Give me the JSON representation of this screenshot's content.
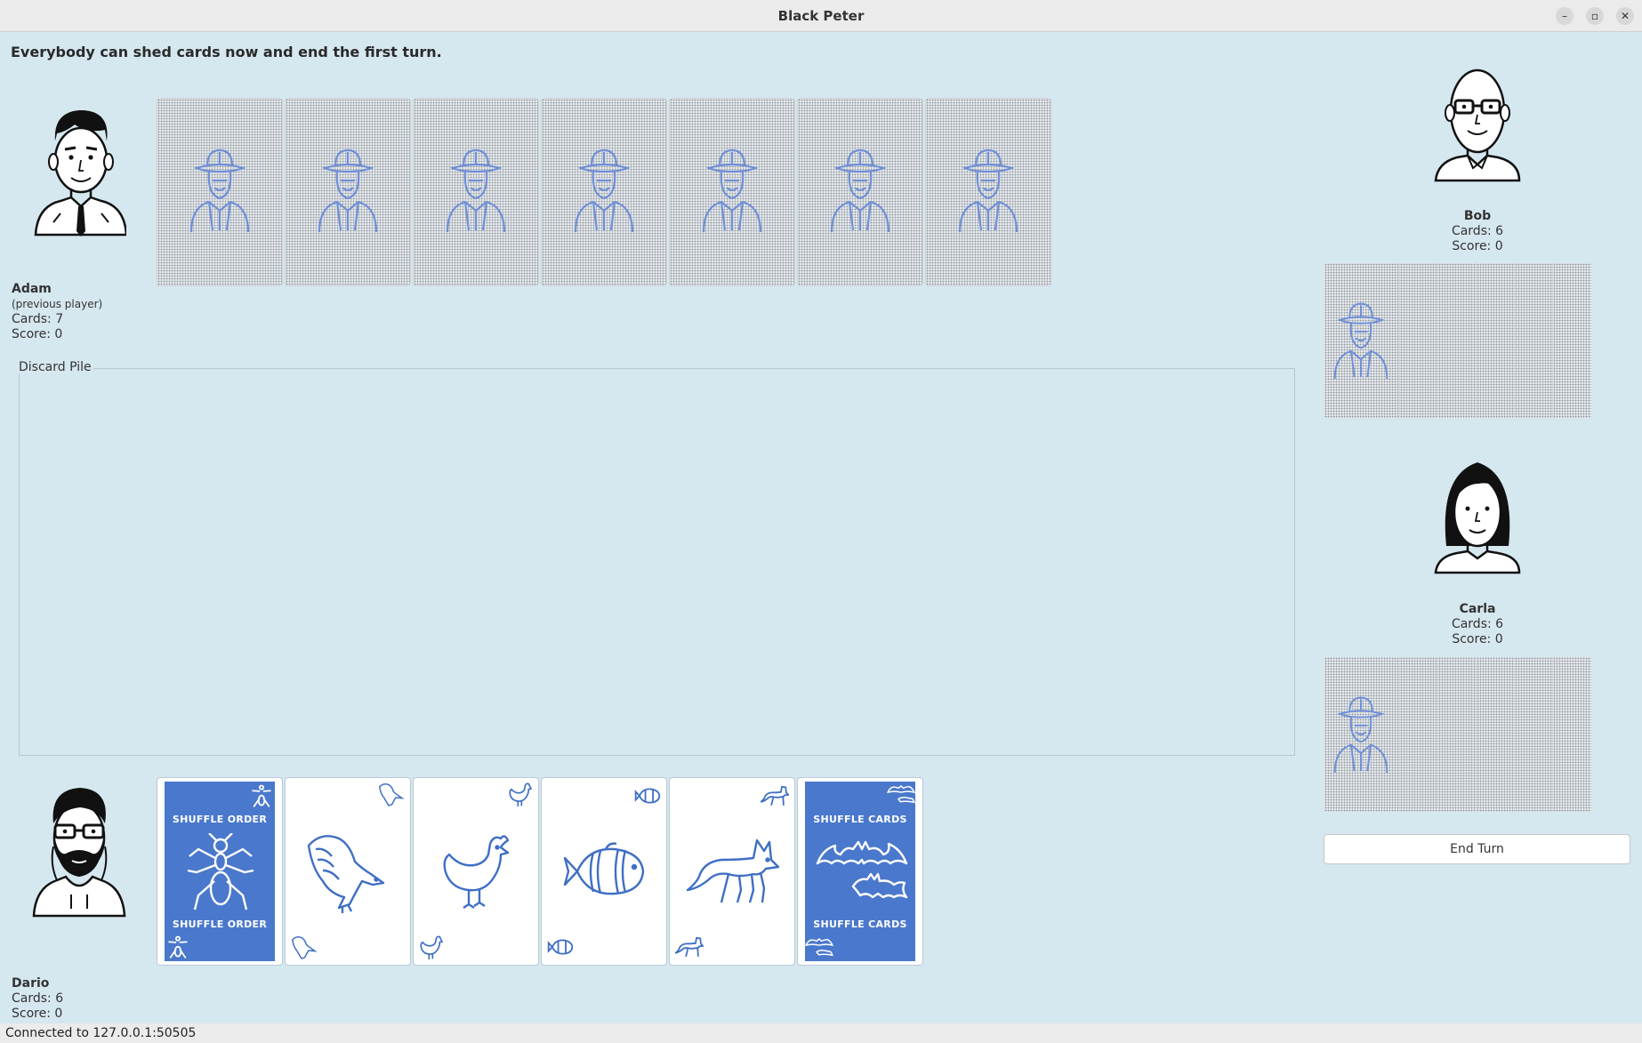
{
  "window": {
    "title": "Black Peter"
  },
  "status_message": "Everybody can shed cards now and end the first turn.",
  "players": {
    "adam": {
      "name": "Adam",
      "note": "(previous player)",
      "cards": "Cards: 7",
      "score": "Score: 0"
    },
    "bob": {
      "name": "Bob",
      "cards": "Cards: 6",
      "score": "Score: 0"
    },
    "carla": {
      "name": "Carla",
      "cards": "Cards: 6",
      "score": "Score: 0"
    },
    "dario": {
      "name": "Dario",
      "cards": "Cards: 6",
      "score": "Score: 0"
    }
  },
  "discard_pile": {
    "label": "Discard Pile"
  },
  "hand": {
    "cards": [
      {
        "kind": "action",
        "top_label": "SHUFFLE ORDER",
        "bottom_label": "SHUFFLE ORDER",
        "icon": "ant-icon"
      },
      {
        "kind": "animal",
        "icon": "eagle-icon"
      },
      {
        "kind": "animal",
        "icon": "chicken-icon"
      },
      {
        "kind": "animal",
        "icon": "clownfish-icon"
      },
      {
        "kind": "animal",
        "icon": "fox-icon"
      },
      {
        "kind": "action",
        "top_label": "SHUFFLE CARDS",
        "bottom_label": "SHUFFLE CARDS",
        "icon": "bat-icon"
      }
    ]
  },
  "buttons": {
    "end_turn": "End Turn"
  },
  "statusbar": {
    "connection": "Connected to 127.0.0.1:50505"
  },
  "colors": {
    "background": "#d5e7ef",
    "card_blue": "#4a78cc",
    "icon_blue": "#3f6fc4"
  }
}
